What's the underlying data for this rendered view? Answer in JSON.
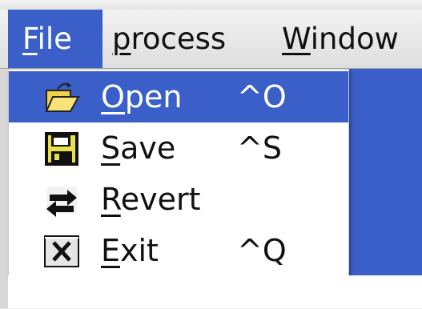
{
  "menubar": {
    "menus": [
      {
        "label": "File",
        "mnemonic": "F",
        "rest": "ile"
      },
      {
        "label": "process",
        "mnemonic": "p",
        "rest": "rocess"
      },
      {
        "label": "Window",
        "mnemonic": "W",
        "rest": "indow"
      }
    ]
  },
  "file_menu": {
    "items": [
      {
        "label": "Open",
        "mnemonic": "O",
        "rest": "pen",
        "shortcut": "^O",
        "icon": "open-folder-icon",
        "selected": true
      },
      {
        "label": "Save",
        "mnemonic": "S",
        "rest": "ave",
        "shortcut": "^S",
        "icon": "floppy-disk-icon",
        "selected": false
      },
      {
        "label": "Revert",
        "mnemonic": "R",
        "rest": "evert",
        "shortcut": "",
        "icon": "revert-arrows-icon",
        "selected": false
      },
      {
        "label": "Exit",
        "mnemonic": "E",
        "rest": "xit",
        "shortcut": "^Q",
        "icon": "exit-x-icon",
        "selected": false
      }
    ]
  },
  "colors": {
    "selection": "#3a5fc8",
    "menubar": "#e6e6e6",
    "menu_bg": "#ffffff"
  }
}
